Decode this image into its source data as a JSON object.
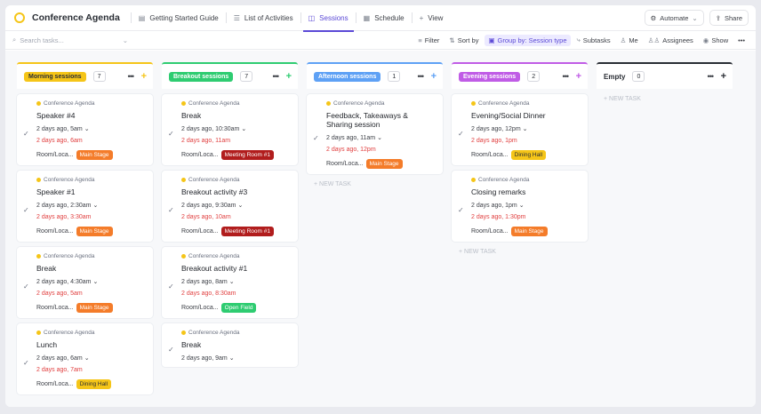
{
  "header": {
    "title": "Conference Agenda",
    "tabs": [
      {
        "label": "Getting Started Guide",
        "icon": "doc-icon",
        "glyph": "▤"
      },
      {
        "label": "List of Activities",
        "icon": "list-icon",
        "glyph": "☰"
      },
      {
        "label": "Sessions",
        "icon": "board-icon",
        "glyph": "◫"
      },
      {
        "label": "Schedule",
        "icon": "calendar-icon",
        "glyph": "▦"
      },
      {
        "label": "View",
        "icon": "plus-icon",
        "glyph": "+"
      }
    ],
    "automate_label": "Automate",
    "share_label": "Share"
  },
  "toolbar": {
    "search_placeholder": "Search tasks...",
    "filter": "Filter",
    "sort": "Sort by",
    "group": "Group by: Session type",
    "subtasks": "Subtasks",
    "me": "Me",
    "assignees": "Assignees",
    "show": "Show",
    "more": "•••"
  },
  "colors": {
    "accent": "#5b49d6",
    "morning": "#f5c518",
    "breakout": "#2ecc71",
    "afternoon": "#5ea1f5",
    "evening": "#c05ce6",
    "main_stage": "#f47c2a",
    "dining_hall": "#f5c518",
    "meeting_room": "#b11d1d",
    "open_field": "#2ecc71",
    "overdue": "#e03e3e"
  },
  "board": {
    "parent_label": "Conference Agenda",
    "field_label": "Room/Loca...",
    "dots": "•••",
    "new_task": "+ NEW TASK",
    "columns": [
      {
        "name": "Morning sessions",
        "count": "7",
        "cards": [
          {
            "title": "Speaker #4",
            "start": "2 days ago, 5am",
            "due": "2 days ago, 6am",
            "room": "Main Stage"
          },
          {
            "title": "Speaker #1",
            "start": "2 days ago, 2:30am",
            "due": "2 days ago, 3:30am",
            "room": "Main Stage"
          },
          {
            "title": "Break",
            "start": "2 days ago, 4:30am",
            "due": "2 days ago, 5am",
            "room": "Main Stage"
          },
          {
            "title": "Lunch",
            "start": "2 days ago, 6am",
            "due": "2 days ago, 7am",
            "room": "Dining Hall"
          }
        ]
      },
      {
        "name": "Breakout sessions",
        "count": "7",
        "cards": [
          {
            "title": "Break",
            "start": "2 days ago, 10:30am",
            "due": "2 days ago, 11am",
            "room": "Meeting Room #1"
          },
          {
            "title": "Breakout activity #3",
            "start": "2 days ago, 9:30am",
            "due": "2 days ago, 10am",
            "room": "Meeting Room #1"
          },
          {
            "title": "Breakout activity #1",
            "start": "2 days ago, 8am",
            "due": "2 days ago, 8:30am",
            "room": "Open Field"
          },
          {
            "title": "Break",
            "start": "2 days ago, 9am",
            "due": "",
            "room": ""
          }
        ]
      },
      {
        "name": "Afternoon sessions",
        "count": "1",
        "cards": [
          {
            "title": "Feedback, Takeaways & Sharing session",
            "start": "2 days ago, 11am",
            "due": "2 days ago, 12pm",
            "room": "Main Stage"
          }
        ]
      },
      {
        "name": "Evening sessions",
        "count": "2",
        "cards": [
          {
            "title": "Evening/Social Dinner",
            "start": "2 days ago, 12pm",
            "due": "2 days ago, 1pm",
            "room": "Dining Hall"
          },
          {
            "title": "Closing remarks",
            "start": "2 days ago, 1pm",
            "due": "2 days ago, 1:30pm",
            "room": "Main Stage"
          }
        ]
      },
      {
        "name": "Empty",
        "count": "0",
        "cards": []
      }
    ]
  }
}
